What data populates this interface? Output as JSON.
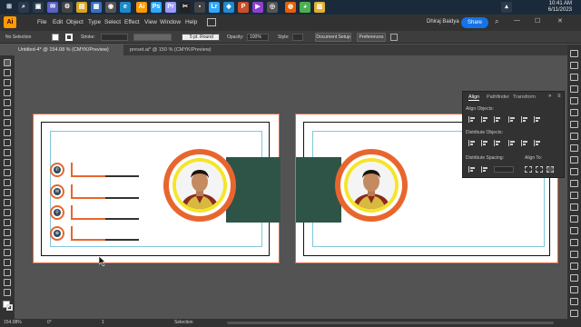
{
  "taskbar": {
    "icons": [
      {
        "name": "windows-start-icon",
        "glyph": "⊞",
        "color": "#1b2a3a"
      },
      {
        "name": "search-icon",
        "glyph": "⌕",
        "color": "#2a3a4a"
      },
      {
        "name": "task-view-icon",
        "glyph": "▣",
        "color": "#2a3a4a"
      },
      {
        "name": "chat-icon",
        "glyph": "✉",
        "color": "#5b5fc7"
      },
      {
        "name": "settings-icon",
        "glyph": "⚙",
        "color": "#444"
      },
      {
        "name": "file-explorer-icon",
        "glyph": "▤",
        "color": "#d9a520"
      },
      {
        "name": "store-icon",
        "glyph": "▦",
        "color": "#3a6fc4"
      },
      {
        "name": "camera-icon",
        "glyph": "◉",
        "color": "#555"
      },
      {
        "name": "edge-icon",
        "glyph": "e",
        "color": "#1e88c9"
      },
      {
        "name": "illustrator-icon",
        "glyph": "Ai",
        "color": "#ff9a00"
      },
      {
        "name": "photoshop-icon",
        "glyph": "Ps",
        "color": "#31a8ff"
      },
      {
        "name": "premiere-icon",
        "glyph": "Pr",
        "color": "#9999ff"
      },
      {
        "name": "capcut-icon",
        "glyph": "✂",
        "color": "#222"
      },
      {
        "name": "sticky-icon",
        "glyph": "▪",
        "color": "#444"
      },
      {
        "name": "lightroom-icon",
        "glyph": "Lr",
        "color": "#31a8ff"
      },
      {
        "name": "vscode-icon",
        "glyph": "◆",
        "color": "#1f8ad2"
      },
      {
        "name": "ppt-icon",
        "glyph": "P",
        "color": "#c94f2b"
      },
      {
        "name": "media-icon",
        "glyph": "▶",
        "color": "#8d3fcf"
      },
      {
        "name": "app-icon",
        "glyph": "◎",
        "color": "#555"
      },
      {
        "name": "firefox-icon",
        "glyph": "◍",
        "color": "#e66000"
      },
      {
        "name": "chrome-icon",
        "glyph": "◕",
        "color": "#4caf50"
      },
      {
        "name": "files-icon",
        "glyph": "▥",
        "color": "#e0b030"
      },
      {
        "name": "more-icon",
        "glyph": "▴",
        "color": "#2a3a4a"
      }
    ],
    "time": "10:41 AM",
    "date": "6/11/2023"
  },
  "menubar": {
    "items": [
      "File",
      "Edit",
      "Object",
      "Type",
      "Select",
      "Effect",
      "View",
      "Window",
      "Help"
    ],
    "user": "Dhiraj Baidya",
    "share_label": "Share"
  },
  "controlbar": {
    "selection": "No Selection",
    "stroke_label": "Stroke:",
    "brush": "5 pt. Round",
    "opacity_label": "Opacity:",
    "opacity_value": "100%",
    "style_label": "Style:",
    "doc_setup": "Document Setup",
    "preferences": "Preferences"
  },
  "tabs": [
    {
      "label": "Untitled-4* @ 154.08 % (CMYK/Preview)",
      "active": true
    },
    {
      "label": "preset.ai* @ 150 % (CMYK/Preview)",
      "active": false
    }
  ],
  "align_panel": {
    "tabs": [
      "Align",
      "Pathfinder",
      "Transform"
    ],
    "sections": {
      "align_objects": "Align Objects:",
      "distribute_objects": "Distribute Objects:",
      "distribute_spacing": "Distribute Spacing:",
      "align_to": "Align To:"
    }
  },
  "statusbar": {
    "zoom": "154.08%",
    "rotation": "0°",
    "artboard_num": "1",
    "tool": "Selection"
  },
  "artwork": {
    "contact_icons": [
      "phone-icon",
      "email-icon",
      "location-icon",
      "web-icon"
    ],
    "contact_glyphs": [
      "✆",
      "✉",
      "⚲",
      "⊕"
    ],
    "accent_orange": "#e8662e",
    "band_green": "#2e5448",
    "ring_yellow": "#f4e52a"
  }
}
